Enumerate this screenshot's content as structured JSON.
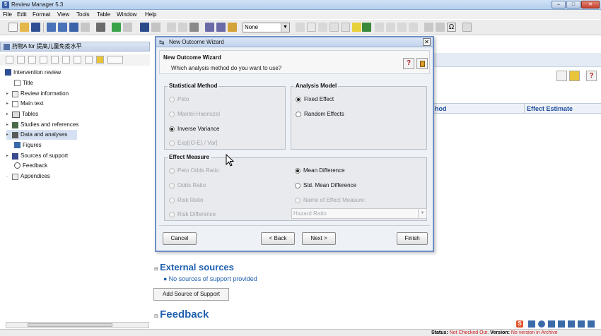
{
  "window": {
    "title": "Review Manager 5.3",
    "app_icon": "5"
  },
  "menu": [
    "File",
    "Edit",
    "Format",
    "View",
    "Tools",
    "Table",
    "Window",
    "Help"
  ],
  "toolbar": {
    "style_value": "None"
  },
  "left_pane": {
    "header": "药物A for 提高儿童免疫水平",
    "tree": [
      {
        "label": "Intervention review",
        "icon": "review-icon"
      },
      {
        "label": "Title",
        "icon": "title-icon"
      },
      {
        "label": "Review information",
        "icon": "info-icon"
      },
      {
        "label": "Main text",
        "icon": "document-icon"
      },
      {
        "label": "Tables",
        "icon": "table-icon"
      },
      {
        "label": "Studies and references",
        "icon": "studies-icon"
      },
      {
        "label": "Data and analyses",
        "icon": "data-icon"
      },
      {
        "label": "Figures",
        "icon": "figure-icon"
      },
      {
        "label": "Sources of support",
        "icon": "support-icon"
      },
      {
        "label": "Feedback",
        "icon": "feedback-icon"
      },
      {
        "label": "Appendices",
        "icon": "appendix-icon"
      }
    ]
  },
  "right_pane": {
    "columns": [
      "hod",
      "Effect Estimate"
    ],
    "external_sources": {
      "title": "External sources",
      "item": "No sources of support provided",
      "add_button": "Add Source of Support"
    },
    "feedback_title": "Feedback"
  },
  "dialog": {
    "title": "New Outcome Wizard",
    "header_title": "New Outcome Wizard",
    "header_sub": "Which analysis method do you want to use?",
    "statistical_method": {
      "label": "Statistical Method",
      "options": [
        {
          "label": "Peto",
          "enabled": false,
          "selected": false
        },
        {
          "label": "Mantel-Haenszel",
          "enabled": false,
          "selected": false
        },
        {
          "label": "Inverse Variance",
          "enabled": true,
          "selected": true
        },
        {
          "label": "Exp[(O-E) / Var]",
          "enabled": false,
          "selected": false
        }
      ]
    },
    "analysis_model": {
      "label": "Analysis Model",
      "options": [
        {
          "label": "Fixed Effect",
          "enabled": true,
          "selected": true
        },
        {
          "label": "Random Effects",
          "enabled": true,
          "selected": false
        }
      ]
    },
    "effect_measure": {
      "label": "Effect Measure",
      "left_options": [
        {
          "label": "Peto Odds Ratio",
          "enabled": false,
          "selected": false
        },
        {
          "label": "Odds Ratio",
          "enabled": false,
          "selected": false
        },
        {
          "label": "Risk Ratio",
          "enabled": false,
          "selected": false
        },
        {
          "label": "Risk Difference",
          "enabled": false,
          "selected": false
        }
      ],
      "right_options": [
        {
          "label": "Mean Difference",
          "enabled": true,
          "selected": true
        },
        {
          "label": "Std. Mean Difference",
          "enabled": true,
          "selected": false
        },
        {
          "label": "Name of Effect Measure:",
          "enabled": false,
          "selected": false
        }
      ],
      "name_placeholder": "Hazard Ratio"
    },
    "buttons": {
      "cancel": "Cancel",
      "back": "< Back",
      "next": "Next >",
      "finish": "Finish"
    }
  },
  "status": {
    "label": "Status:",
    "checked": "Not Checked Out.",
    "version_label": "Version:",
    "version": "No version in Archive"
  },
  "colors": {
    "link_blue": "#1f5fae",
    "status_red": "#c81e1e",
    "dialog_border": "#6e8fc7"
  }
}
